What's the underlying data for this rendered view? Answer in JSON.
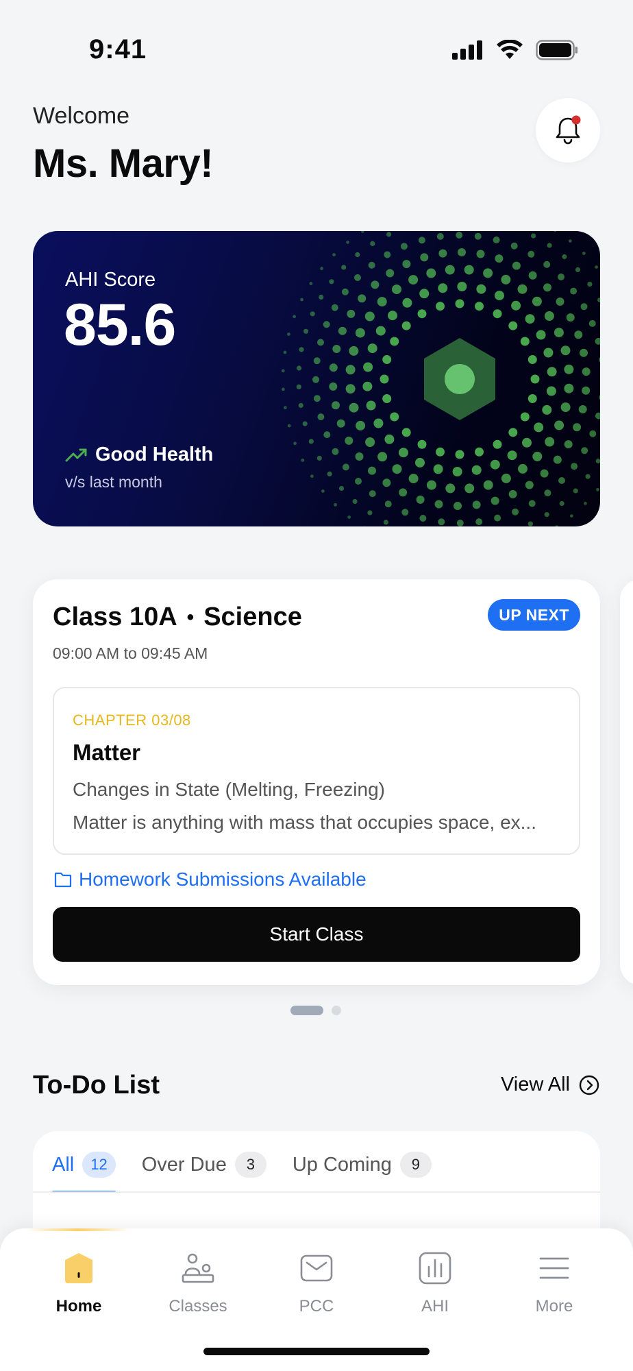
{
  "status_bar": {
    "time": "9:41"
  },
  "header": {
    "welcome_label": "Welcome",
    "name": "Ms. Mary!"
  },
  "ahi_card": {
    "label": "AHI Score",
    "score": "85.6",
    "health_status": "Good Health",
    "comparison": "v/s last month",
    "accent_color": "#4caf50"
  },
  "class_card": {
    "class_name": "Class 10A",
    "subject": "Science",
    "time_range": "09:00 AM to 09:45 AM",
    "badge": "UP NEXT",
    "chapter_label": "CHAPTER 03/08",
    "chapter_title": "Matter",
    "chapter_subtitle": "Changes in State (Melting, Freezing)",
    "chapter_description": "Matter is anything with mass that occupies space, ex...",
    "homework_link": "Homework Submissions Available",
    "start_button": "Start Class"
  },
  "todo": {
    "title": "To-Do List",
    "view_all": "View All",
    "tabs": [
      {
        "label": "All",
        "count": "12"
      },
      {
        "label": "Over Due",
        "count": "3"
      },
      {
        "label": "Up Coming",
        "count": "9"
      }
    ]
  },
  "bottom_nav": {
    "items": [
      {
        "label": "Home",
        "icon": "home-icon"
      },
      {
        "label": "Classes",
        "icon": "classes-icon"
      },
      {
        "label": "PCC",
        "icon": "mail-icon"
      },
      {
        "label": "AHI",
        "icon": "chart-icon"
      },
      {
        "label": "More",
        "icon": "menu-icon"
      }
    ]
  },
  "colors": {
    "primary_blue": "#1f6ff2",
    "chapter_yellow": "#e6b71e",
    "home_yellow": "#f9cf6a",
    "card_navy": "#0a0f5e"
  }
}
